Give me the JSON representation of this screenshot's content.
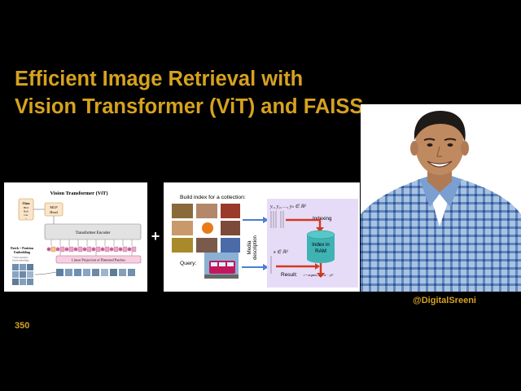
{
  "title": {
    "line1": "Efficient Image Retrieval with",
    "line2": "Vision Transformer (ViT) and FAISS"
  },
  "vit_diagram": {
    "heading": "Vision Transformer (ViT)",
    "class_box": [
      "Class",
      "Bird",
      "Ball",
      "Car",
      "..."
    ],
    "mlp_head": [
      "MLP",
      "Head"
    ],
    "encoder": "Transformer Encoder",
    "embedding_label": [
      "Patch + Position",
      "Embedding"
    ],
    "embedding_note": [
      "* Extra learnable",
      "[class] embedding"
    ],
    "projection": "Linear Projection of Flattened Patches",
    "token_labels": [
      "0*",
      "1",
      "2",
      "3",
      "4",
      "5",
      "6",
      "7",
      "8",
      "9"
    ]
  },
  "plus_sign": "+",
  "faiss_diagram": {
    "build_label": "Build index for a collection:",
    "query_label": "Query:",
    "media_label": "Media",
    "description_label": "description",
    "vectors_math": "y₁, y₂, …, yₙ ∈ ℝᵈ",
    "query_math": "x ∈ ℝᵈ",
    "indexing_label": "Indexing",
    "index_label": [
      "Index in",
      "RAM"
    ],
    "result_label": "Result:",
    "result_math": "i = argminᵢ₌₁..ₙ ‖x − yᵢ‖²"
  },
  "presenter": {
    "handle": "@DigitalSreeni"
  },
  "video_number": "350",
  "colors": {
    "accent": "#d6a21e",
    "background": "#000000",
    "lavender_panel": "#e7dcf8",
    "arrow_blue": "#4a7fd4",
    "arrow_red": "#d23a1e",
    "cylinder": "#3fb3b4"
  }
}
